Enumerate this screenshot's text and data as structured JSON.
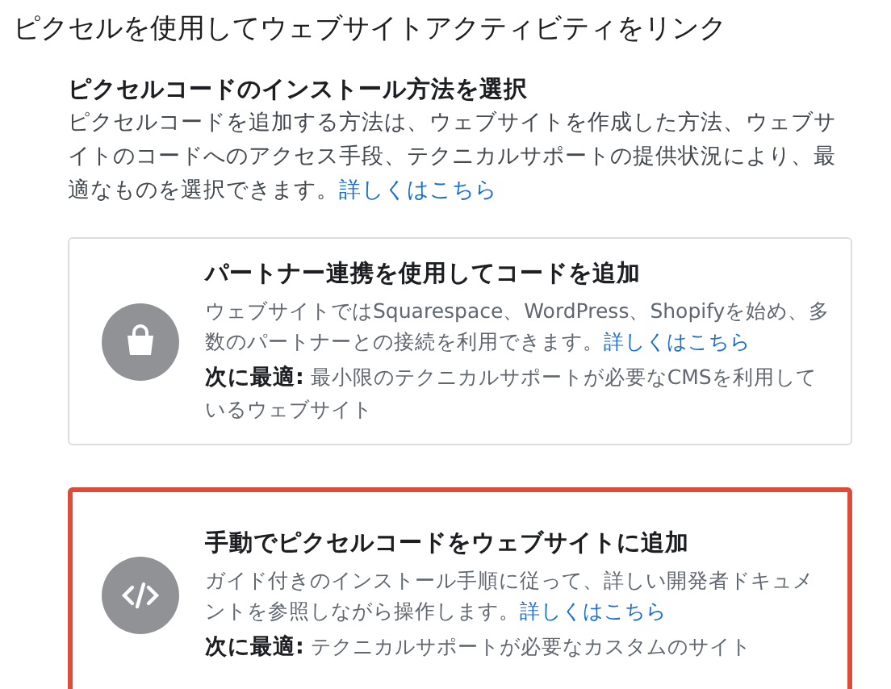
{
  "title": "ピクセルを使用してウェブサイトアクティビティをリンク",
  "section": {
    "heading": "ピクセルコードのインストール方法を選択",
    "description": "ピクセルコードを追加する方法は、ウェブサイトを作成した方法、ウェブサイトのコードへのアクセス手段、テクニカルサポートの提供状況により、最適なものを選択できます。",
    "link": "詳しくはこちら"
  },
  "options": [
    {
      "kind": "partner",
      "title": "パートナー連携を使用してコードを追加",
      "description": "ウェブサイトではSquarespace、WordPress、Shopifyを始め、多数のパートナーとの接続を利用できます。",
      "link": "詳しくはこちら",
      "best_for": "**次に最適:** 最小限のテクニカルサポートが必要なCMSを利用しているウェブサイト",
      "highlighted": false
    },
    {
      "kind": "manual",
      "title": "手動でピクセルコードをウェブサイトに追加",
      "description": "ガイド付きのインストール手順に従って、詳しい開発者ドキュメントを参照しながら操作します。",
      "link": "詳しくはこちら",
      "best_for": "**次に最適:** テクニカルサポートが必要なカスタムのサイト",
      "highlighted": true
    }
  ]
}
